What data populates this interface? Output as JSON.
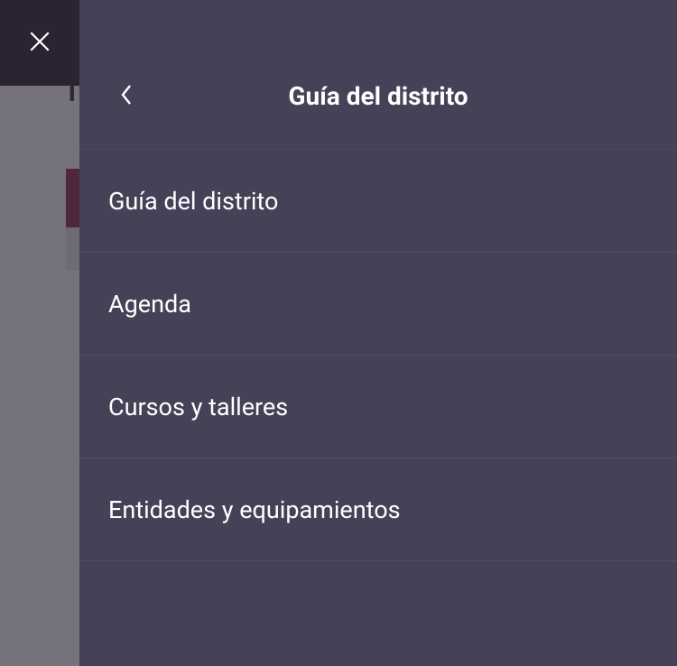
{
  "backdrop": {
    "partial_text": "Tr"
  },
  "panel": {
    "title": "Guía del distrito",
    "items": [
      {
        "label": "Guía del distrito"
      },
      {
        "label": "Agenda"
      },
      {
        "label": "Cursos y talleres"
      },
      {
        "label": "Entidades y equipamientos"
      }
    ]
  }
}
